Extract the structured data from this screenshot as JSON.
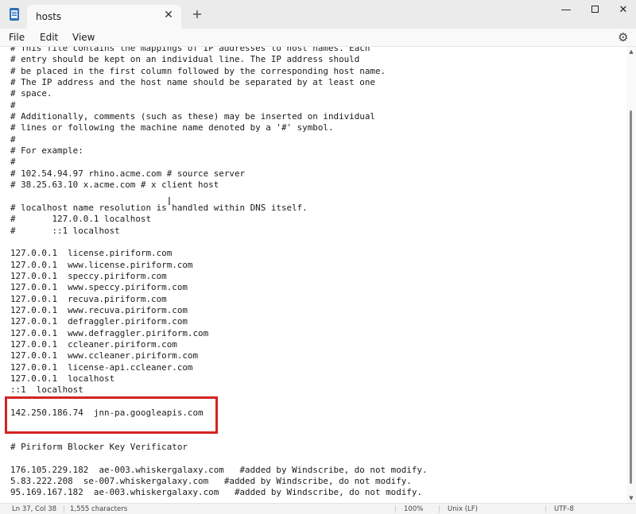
{
  "window": {
    "tab_title": "hosts",
    "close_tab_glyph": "✕",
    "new_tab_glyph": "+",
    "minimize_glyph": "—",
    "close_glyph": "✕"
  },
  "menu": {
    "file": "File",
    "edit": "Edit",
    "view": "View"
  },
  "icons": {
    "app": "notepad-icon",
    "settings": "gear-icon",
    "settings_glyph": "⚙"
  },
  "editor": {
    "lines": [
      "# This file contains the mappings of IP addresses to host names. Each",
      "# entry should be kept on an individual line. The IP address should",
      "# be placed in the first column followed by the corresponding host name.",
      "# The IP address and the host name should be separated by at least one",
      "# space.",
      "#",
      "# Additionally, comments (such as these) may be inserted on individual",
      "# lines or following the machine name denoted by a '#' symbol.",
      "#",
      "# For example:",
      "#",
      "# 102.54.94.97 rhino.acme.com # source server",
      "# 38.25.63.10 x.acme.com # x client host",
      "",
      "# localhost name resolution is handled within DNS itself.",
      "#       127.0.0.1 localhost",
      "#       ::1 localhost",
      "",
      "127.0.0.1  license.piriform.com",
      "127.0.0.1  www.license.piriform.com",
      "127.0.0.1  speccy.piriform.com",
      "127.0.0.1  www.speccy.piriform.com",
      "127.0.0.1  recuva.piriform.com",
      "127.0.0.1  www.recuva.piriform.com",
      "127.0.0.1  defraggler.piriform.com",
      "127.0.0.1  www.defraggler.piriform.com",
      "127.0.0.1  ccleaner.piriform.com",
      "127.0.0.1  www.ccleaner.piriform.com",
      "127.0.0.1  license-api.ccleaner.com",
      "127.0.0.1  localhost",
      "::1  localhost",
      "",
      "142.250.186.74  jnn-pa.googleapis.com",
      "",
      "",
      "# Piriform Blocker Key Verificator",
      "",
      "176.105.229.182  ae-003.whiskergalaxy.com   #added by Windscribe, do not modify.",
      "5.83.222.208  se-007.whiskergalaxy.com   #added by Windscribe, do not modify.",
      "95.169.167.182  ae-003.whiskergalaxy.com   #added by Windscribe, do not modify."
    ],
    "highlight_color": "#d32323"
  },
  "status": {
    "position": "Ln 37, Col 38",
    "characters": "1,555 characters",
    "zoom": "100%",
    "line_ending": "Unix (LF)",
    "encoding": "UTF-8"
  }
}
